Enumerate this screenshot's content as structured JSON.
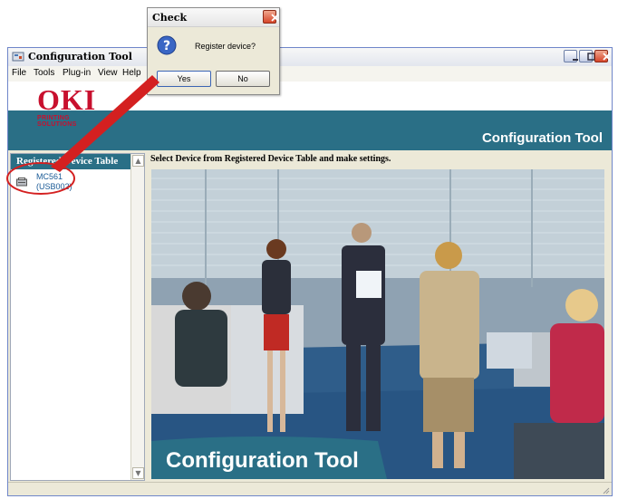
{
  "window": {
    "title": "Configuration Tool"
  },
  "menu": [
    "File",
    "Tools",
    "Plug-in",
    "View",
    "Help"
  ],
  "logo": {
    "brand": "OKI",
    "tagline": "PRINTING SOLUTIONS"
  },
  "banner": {
    "title": "Configuration Tool"
  },
  "left_panel": {
    "header": "Registered Device Table",
    "device": {
      "name": "MC561",
      "port": "(USB002)"
    }
  },
  "main": {
    "instruction": "Select Device from Registered Device Table and make settings.",
    "image_caption": "Configuration Tool"
  },
  "dialog": {
    "title": "Check",
    "message": "Register device?",
    "yes_label": "Yes",
    "no_label": "No"
  },
  "colors": {
    "brand_red": "#c8102e",
    "teal": "#2a6f86",
    "annotation_red": "#d42020"
  },
  "icons": [
    "app-icon",
    "minimize-icon",
    "maximize-icon",
    "close-icon",
    "question-icon",
    "printer-icon",
    "chevron-up-icon",
    "chevron-down-icon"
  ]
}
